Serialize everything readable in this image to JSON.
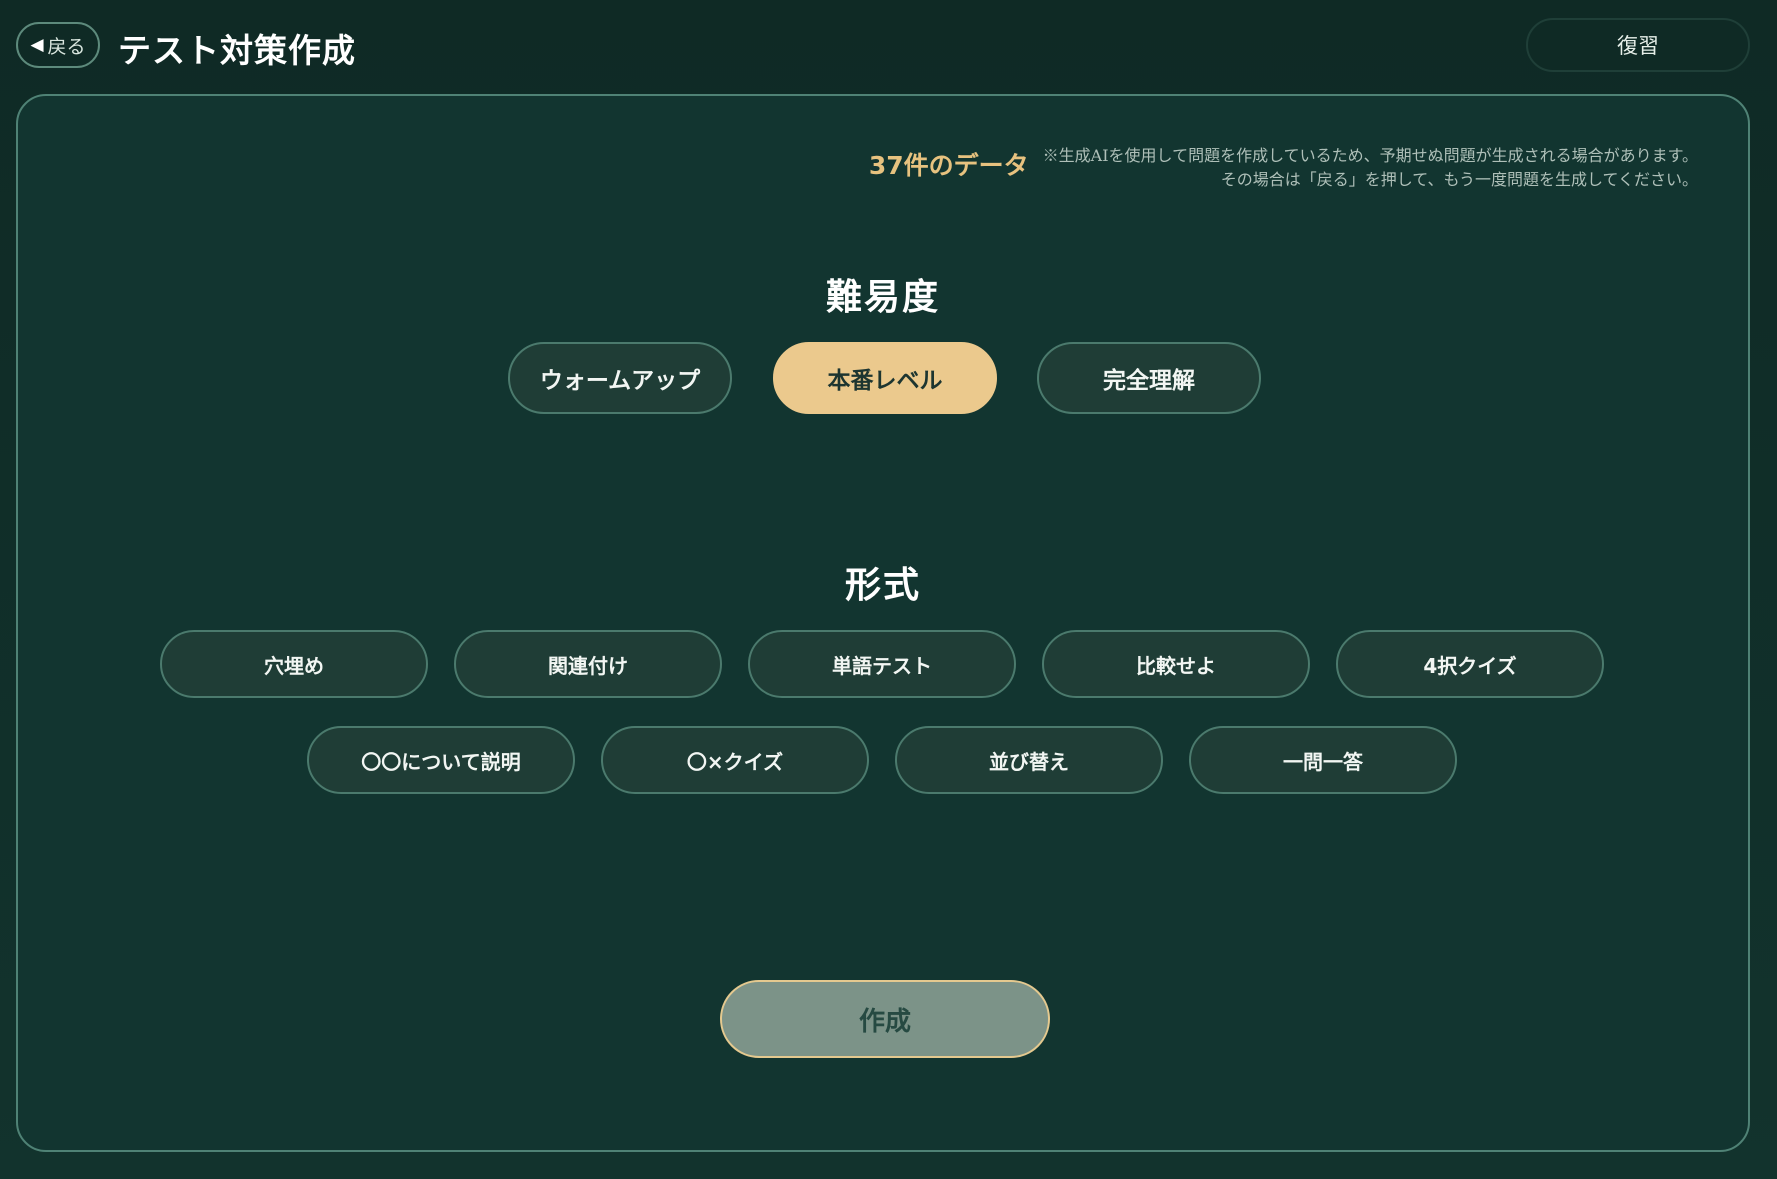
{
  "header": {
    "back_arrow": "◀",
    "back_label": "戻る",
    "title": "テスト対策作成",
    "review_label": "復習"
  },
  "notice": {
    "data_count": "37件のデータ",
    "line1": "※生成AIを使用して問題を作成しているため、予期せぬ問題が生成される場合があります。",
    "line2": "その場合は「戻る」を押して、もう一度問題を生成してください。"
  },
  "difficulty": {
    "title": "難易度",
    "options": [
      "ウォームアップ",
      "本番レベル",
      "完全理解"
    ],
    "selected": "本番レベル"
  },
  "format": {
    "title": "形式",
    "options_row1": [
      "穴埋め",
      "関連付け",
      "単語テスト",
      "比較せよ",
      "4択クイズ"
    ],
    "options_row2": [
      "〇〇について説明",
      "〇×クイズ",
      "並び替え",
      "一問一答"
    ]
  },
  "actions": {
    "create_label": "作成"
  },
  "colors": {
    "background": "#12332d",
    "accent": "#ebc98d",
    "border": "#4f8275",
    "pill": "#1f3d36",
    "disabled_button": "#7c9388"
  }
}
